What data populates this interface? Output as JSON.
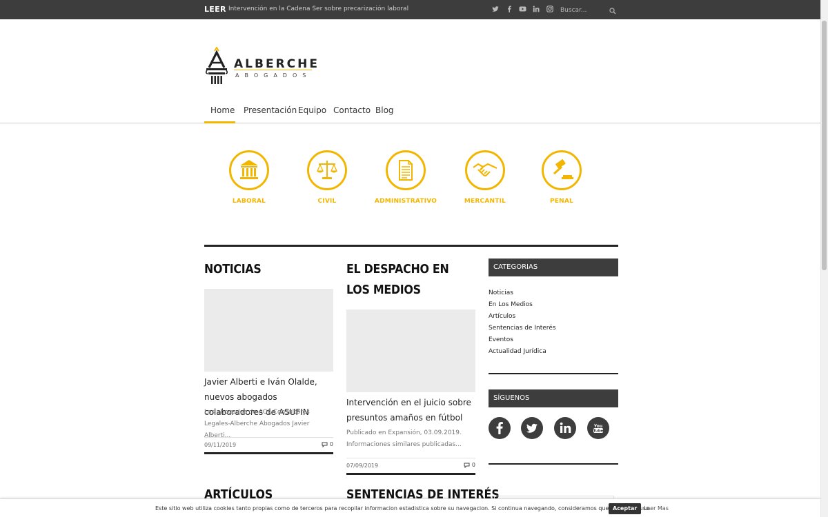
{
  "topbar": {
    "leer_label": "LEER",
    "ticker_text": "Intervención en la Cadena Ser sobre precarización laboral",
    "social_icons": [
      "twitter-icon",
      "facebook-icon",
      "youtube-icon",
      "linkedin-icon",
      "instagram-icon"
    ],
    "search_placeholder": "Buscar..."
  },
  "logo": {
    "brand": "ALBERCHE",
    "subtitle": "ABOGADOS"
  },
  "nav": {
    "items": [
      "Home",
      "Presentación",
      "Equipo",
      "Contacto",
      "Blog"
    ],
    "active": "Home"
  },
  "areas": [
    {
      "label": "LABORAL",
      "icon": "bank-icon"
    },
    {
      "label": "CIVIL",
      "icon": "scales-icon"
    },
    {
      "label": "ADMINISTRATIVO",
      "icon": "document-icon"
    },
    {
      "label": "MERCANTIL",
      "icon": "handshake-icon"
    },
    {
      "label": "PENAL",
      "icon": "gavel-icon"
    }
  ],
  "noticias": {
    "title": "NOTICIAS",
    "post": {
      "title": "Javier Alberti e Iván Olalde, nuevos abogados colaboradores de ASUFIN",
      "excerpt": "Los abogados de AOL Consultores Legales-Alberche Abogados Javier Alberti...",
      "date": "09/11/2019",
      "comments": "0"
    }
  },
  "medios": {
    "title": "EL DESPACHO EN LOS MEDIOS",
    "post": {
      "title": "Intervención en el juicio sobre presuntos amaños en fútbol",
      "excerpt": "Publicado en Expansión, 03.09.2019. Informaciones similares publicadas...",
      "date": "07/09/2019",
      "comments": "0"
    }
  },
  "sidebar": {
    "categories_title": "CATEGORIAS",
    "categories": [
      "Noticias",
      "En Los Medios",
      "Artículos",
      "Sentencias de Interés",
      "Eventos",
      "Actualidad Jurídica"
    ],
    "follow_title": "SÍGUENOS",
    "follow_icons": [
      "facebook-icon",
      "twitter-icon",
      "linkedin-icon",
      "youtube-icon"
    ]
  },
  "bottom": {
    "articulos_title": "ARTÍCULOS",
    "sentencias_title": "SENTENCIAS DE INTERÉS"
  },
  "cookie": {
    "message": "Este sitio web utiliza cookies tanto propias como de terceros para recopilar informacion estadistica sobre su navegacion. Si continua navegando, consideramos que acepta su uso.",
    "accept_label": "Aceptar",
    "more_label": "Leer Mas"
  },
  "colors": {
    "accent": "#f3b600",
    "dark": "#3d3d3d",
    "text": "#222222"
  }
}
